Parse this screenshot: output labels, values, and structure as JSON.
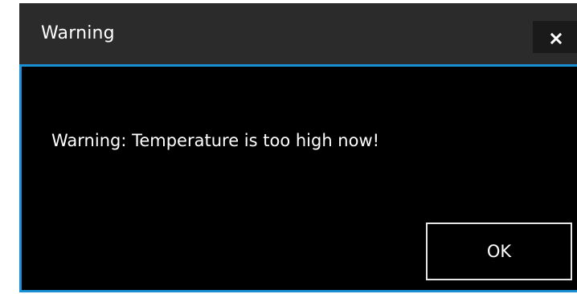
{
  "dialog": {
    "title": "Warning",
    "close_label": "×",
    "message": "Warning: Temperature is too high now!",
    "ok_label": "OK"
  },
  "colors": {
    "titlebar": "#2b2b2b",
    "content_background": "#000000",
    "accent_border": "#1a8fd6",
    "text": "#ffffff"
  }
}
